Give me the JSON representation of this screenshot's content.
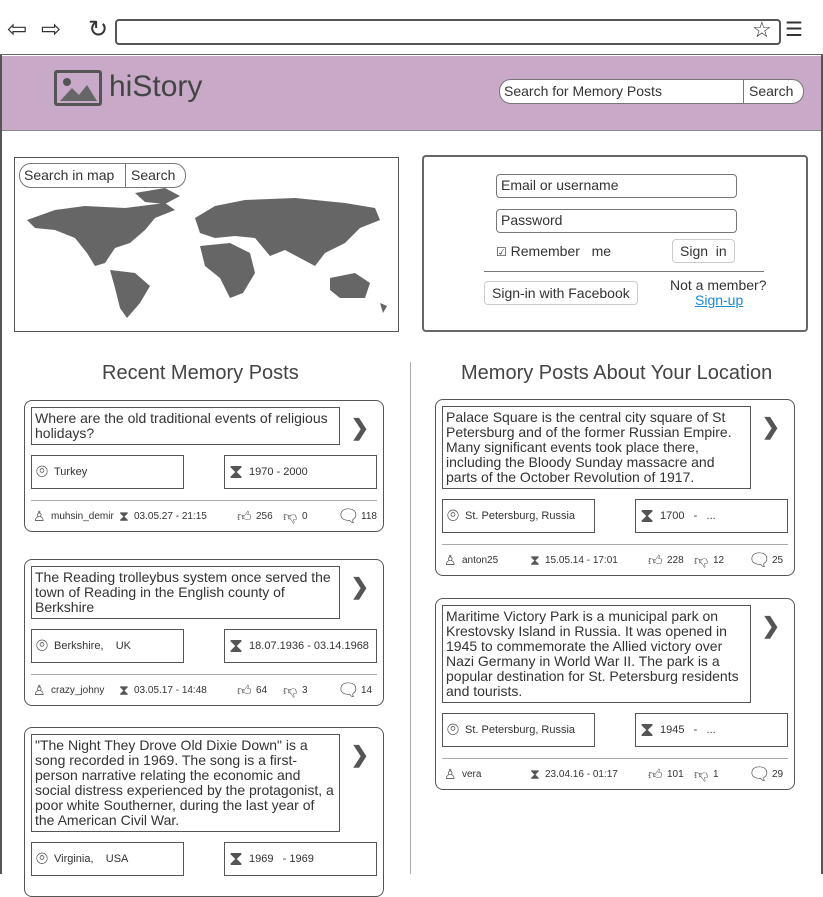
{
  "browser": {
    "back_icon": "arrow-left",
    "forward_icon": "arrow-right",
    "reload_icon": "reload",
    "star_icon": "star",
    "menu_icon": "hamburger"
  },
  "header": {
    "brand": "hiStory",
    "search_placeholder": "Search for Memory Posts",
    "search_button": "Search"
  },
  "map": {
    "search_placeholder": "Search in map",
    "search_button": "Search"
  },
  "login": {
    "email_placeholder": "Email or username",
    "password_placeholder": "Password",
    "remember": "Remember   me",
    "remember_checked": true,
    "signin": "Sign  in",
    "facebook": "Sign-in with Facebook",
    "not_member": "Not a member?",
    "signup": "Sign-up"
  },
  "recent": {
    "title": "Recent Memory Posts",
    "posts": [
      {
        "text": "Where are the old traditional events of religious holidays?",
        "location": "Turkey",
        "period": "1970 - 2000",
        "user": "muhsin_demir",
        "date": "03.05.27 - 21:15",
        "likes": "256",
        "dislikes": "0",
        "comments": "118"
      },
      {
        "text": "The Reading trolleybus system once served the town of Reading in the English county of Berkshire",
        "location": "Berkshire,    UK",
        "period": "18.07.1936 - 03.14.1968",
        "user": "crazy_johny",
        "date": "03.05.17 - 14:48",
        "likes": "64",
        "dislikes": "3",
        "comments": "14"
      },
      {
        "text": "\"The Night They Drove Old Dixie Down\" is a song recorded in 1969.  The song is a first-person narrative relating the economic and social distress experienced by the protagonist, a poor white Southerner, during the last year of the American Civil War.",
        "location": "Virginia,    USA",
        "period": "1969   - 1969"
      }
    ]
  },
  "local": {
    "title": "Memory Posts About Your Location",
    "posts": [
      {
        "text": "Palace Square  is the central city square of St Petersburg and of the former Russian Empire. Many significant events took place there, including the Bloody Sunday massacre and parts of the October Revolution of 1917.",
        "location": "St. Petersburg, Russia",
        "period": "1700   -   ...",
        "user": "anton25",
        "date": "15.05.14 - 17:01",
        "likes": "228",
        "dislikes": "12",
        "comments": "25"
      },
      {
        "text": "Maritime Victory Park is a municipal park on Krestovsky Island in Russia. It was opened in 1945 to commemorate the Allied victory over Nazi Germany in World War II. The park is a popular destination for St. Petersburg residents and tourists.",
        "location": "St. Petersburg, Russia",
        "period": "1945   -   ...",
        "user": "vera",
        "date": "23.04.16 - 01:17",
        "likes": "101",
        "dislikes": "1",
        "comments": "29"
      }
    ]
  }
}
